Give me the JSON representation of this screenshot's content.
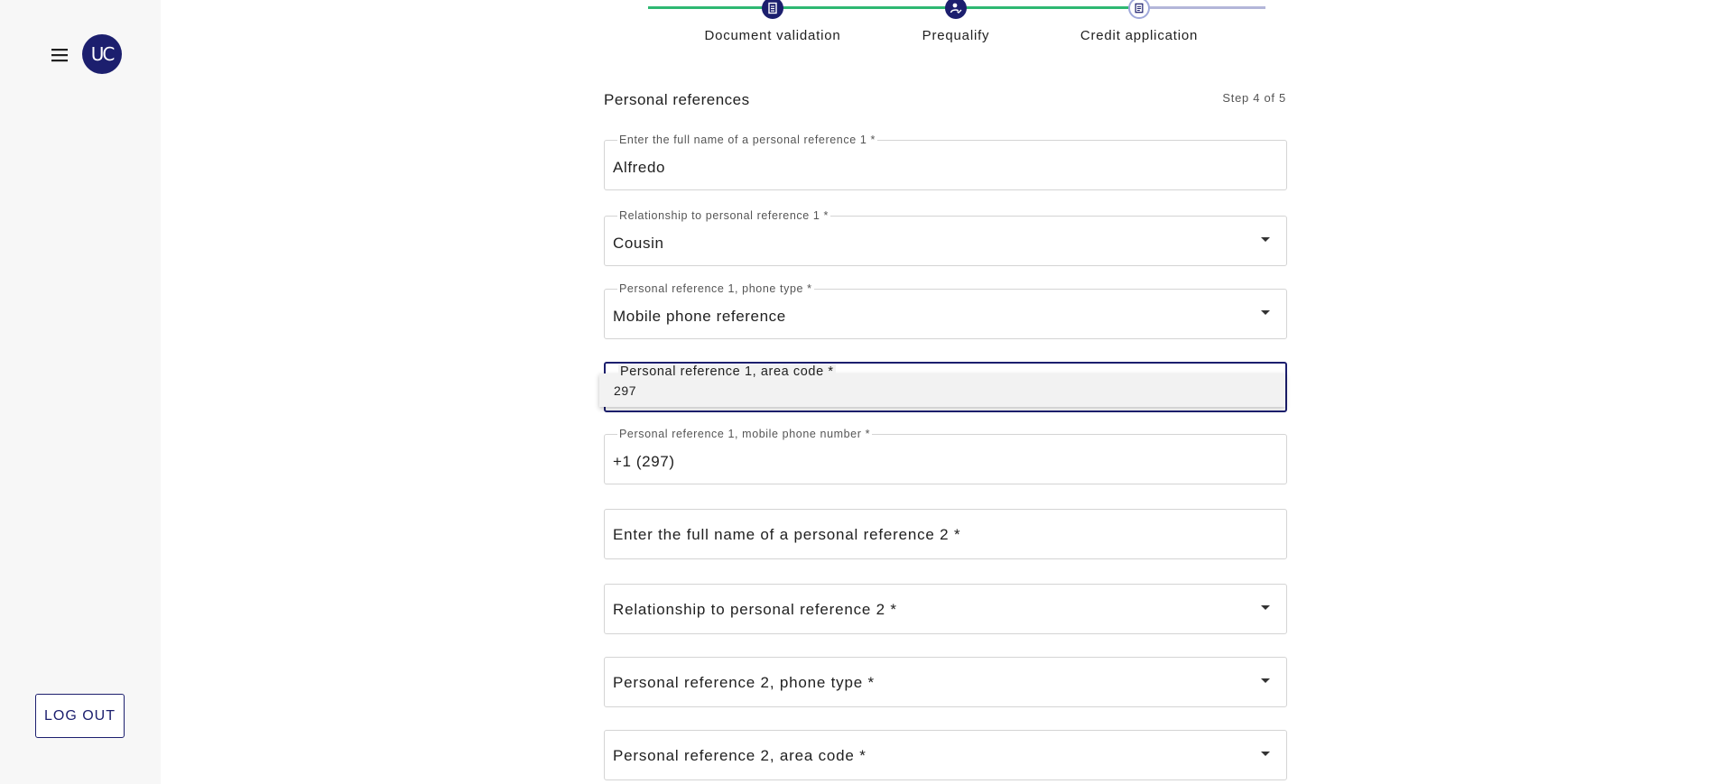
{
  "sidebar": {
    "menu_icon": "menu-icon",
    "avatar_text": "UC",
    "logout_label": "LOG OUT"
  },
  "stepper": {
    "steps": [
      {
        "label": "Document validation",
        "icon": "document-icon",
        "status": "complete"
      },
      {
        "label": "Prequalify",
        "icon": "user-check-icon",
        "status": "complete"
      },
      {
        "label": "Credit application",
        "icon": "form-icon",
        "status": "current"
      }
    ],
    "colors": {
      "complete": "#2eb872",
      "pending": "#b3b6d9",
      "icon_bg": "#1c1f6e"
    }
  },
  "form": {
    "section_title": "Personal references",
    "step_counter": "Step 4 of 5",
    "fields": {
      "ref1_name": {
        "label": "Enter the full name of a personal reference 1 *",
        "value": "Alfredo"
      },
      "ref1_relationship": {
        "label": "Relationship to personal reference 1 *",
        "value": "Cousin"
      },
      "ref1_phone_type": {
        "label": "Personal reference 1, phone type *",
        "value": "Mobile phone reference"
      },
      "ref1_area_code": {
        "label": "Personal reference 1, area code *",
        "value": ""
      },
      "ref1_mobile_number": {
        "label": "Personal reference 1, mobile phone number *",
        "value": "+1 (297)"
      },
      "ref2_name": {
        "placeholder": "Enter the full name of a personal reference 2 *"
      },
      "ref2_relationship": {
        "placeholder": "Relationship to personal reference 2 *"
      },
      "ref2_phone_type": {
        "placeholder": "Personal reference 2, phone type *"
      },
      "ref2_area_code": {
        "placeholder": "Personal reference 2, area code *"
      }
    },
    "area_code_options": [
      "297"
    ]
  },
  "colors": {
    "primary": "#1c1f6e",
    "sidebar_bg": "#f7f7f7"
  }
}
